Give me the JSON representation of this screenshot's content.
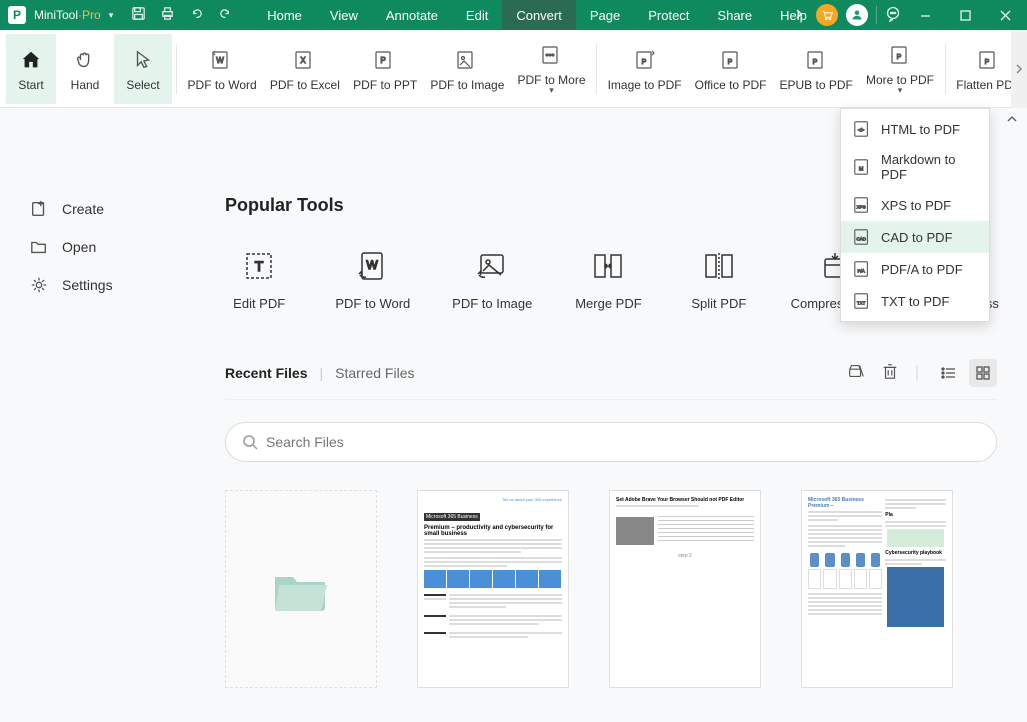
{
  "app": {
    "name": "MiniTool",
    "suffix": "Pro"
  },
  "menus": [
    "Home",
    "View",
    "Annotate",
    "Edit",
    "Convert",
    "Page",
    "Protect",
    "Share",
    "Help"
  ],
  "active_menu": "Convert",
  "ribbon": {
    "start": "Start",
    "hand": "Hand",
    "select": "Select",
    "pdf_to_word": "PDF to Word",
    "pdf_to_excel": "PDF to Excel",
    "pdf_to_ppt": "PDF to PPT",
    "pdf_to_image": "PDF to Image",
    "pdf_to_more": "PDF to More",
    "image_to_pdf": "Image to PDF",
    "office_to_pdf": "Office to PDF",
    "epub_to_pdf": "EPUB to PDF",
    "more_to_pdf": "More to PDF",
    "flatten_pdf": "Flatten PDF"
  },
  "dropdown": {
    "html": "HTML to PDF",
    "markdown": "Markdown to PDF",
    "xps": "XPS to PDF",
    "cad": "CAD to PDF",
    "pdfa": "PDF/A to PDF",
    "txt": "TXT to PDF"
  },
  "sidebar": {
    "create": "Create",
    "open": "Open",
    "settings": "Settings"
  },
  "popular": {
    "title": "Popular Tools",
    "edit_pdf": "Edit PDF",
    "pdf_to_word": "PDF to Word",
    "pdf_to_image": "PDF to Image",
    "merge_pdf": "Merge PDF",
    "split_pdf": "Split PDF",
    "compress_pdf": "Compress PDF",
    "batch_process": "Batch Process"
  },
  "files": {
    "recent": "Recent Files",
    "starred": "Starred Files",
    "search_placeholder": "Search Files"
  }
}
